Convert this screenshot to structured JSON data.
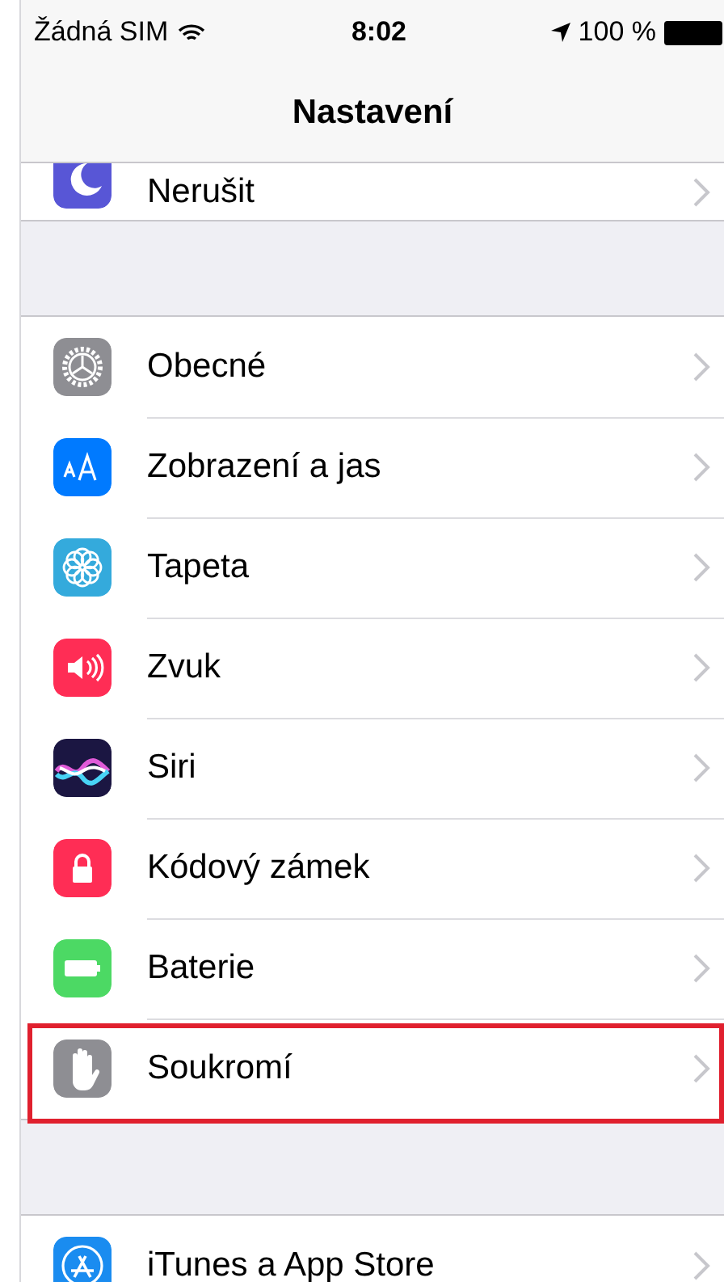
{
  "status_bar": {
    "carrier": "Žádná SIM",
    "time": "8:02",
    "battery": "100 %"
  },
  "nav_bar": {
    "title": "Nastavení"
  },
  "groups": [
    {
      "items": [
        {
          "label": "Nerušit",
          "kind": "moon",
          "highlighted": false
        }
      ]
    },
    {
      "items": [
        {
          "label": "Obecné",
          "kind": "gear",
          "highlighted": false
        },
        {
          "label": "Zobrazení a jas",
          "kind": "textsize",
          "highlighted": false
        },
        {
          "label": "Tapeta",
          "kind": "flower",
          "highlighted": false
        },
        {
          "label": "Zvuk",
          "kind": "speaker",
          "highlighted": false
        },
        {
          "label": "Siri",
          "kind": "siri",
          "highlighted": false
        },
        {
          "label": "Kódový zámek",
          "kind": "lock",
          "highlighted": false
        },
        {
          "label": "Baterie",
          "kind": "battery",
          "highlighted": false
        },
        {
          "label": "Soukromí",
          "kind": "hand",
          "highlighted": true
        }
      ]
    },
    {
      "items": [
        {
          "label": "iTunes a App Store",
          "kind": "appstore",
          "highlighted": false
        }
      ]
    }
  ]
}
